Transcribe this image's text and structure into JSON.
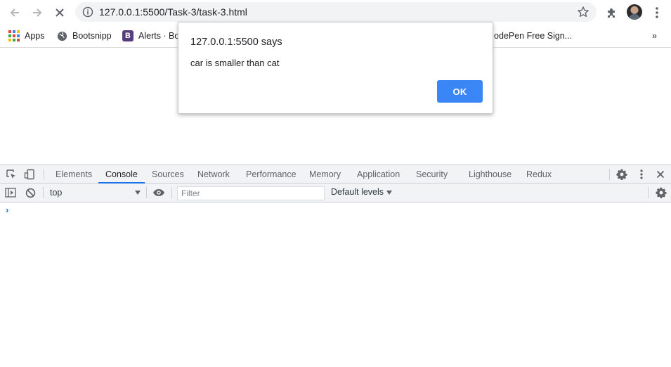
{
  "browser": {
    "url": "127.0.0.1:5500/Task-3/task-3.html",
    "icons": {
      "back": "arrow-left-icon",
      "forward": "arrow-right-icon",
      "stop": "stop-loading-icon",
      "site_info": "info-icon",
      "bookmark": "star-icon",
      "extensions": "puzzle-icon",
      "profile": "avatar",
      "menu": "kebab-menu-icon"
    }
  },
  "bookmarks": {
    "items": [
      {
        "label": "Apps",
        "icon": "apps-grid-icon"
      },
      {
        "label": "Bootsnipp",
        "icon": "globe-icon"
      },
      {
        "label": "Alerts · Boo",
        "icon": "bootstrap-icon"
      },
      {
        "label": "odePen Free Sign...",
        "icon": ""
      }
    ],
    "overflow": "»"
  },
  "dialog": {
    "title": "127.0.0.1:5500 says",
    "message": "car is smaller than cat",
    "ok_label": "OK"
  },
  "devtools": {
    "tabs": [
      "Elements",
      "Console",
      "Sources",
      "Network",
      "Performance",
      "Memory",
      "Application",
      "Security",
      "Lighthouse",
      "Redux"
    ],
    "active_tab": "Console",
    "context": "top",
    "filter_placeholder": "Filter",
    "levels_label": "Default levels",
    "prompt": "›"
  },
  "colors": {
    "accent": "#1a73e8",
    "ok_button": "#3b86f7"
  }
}
